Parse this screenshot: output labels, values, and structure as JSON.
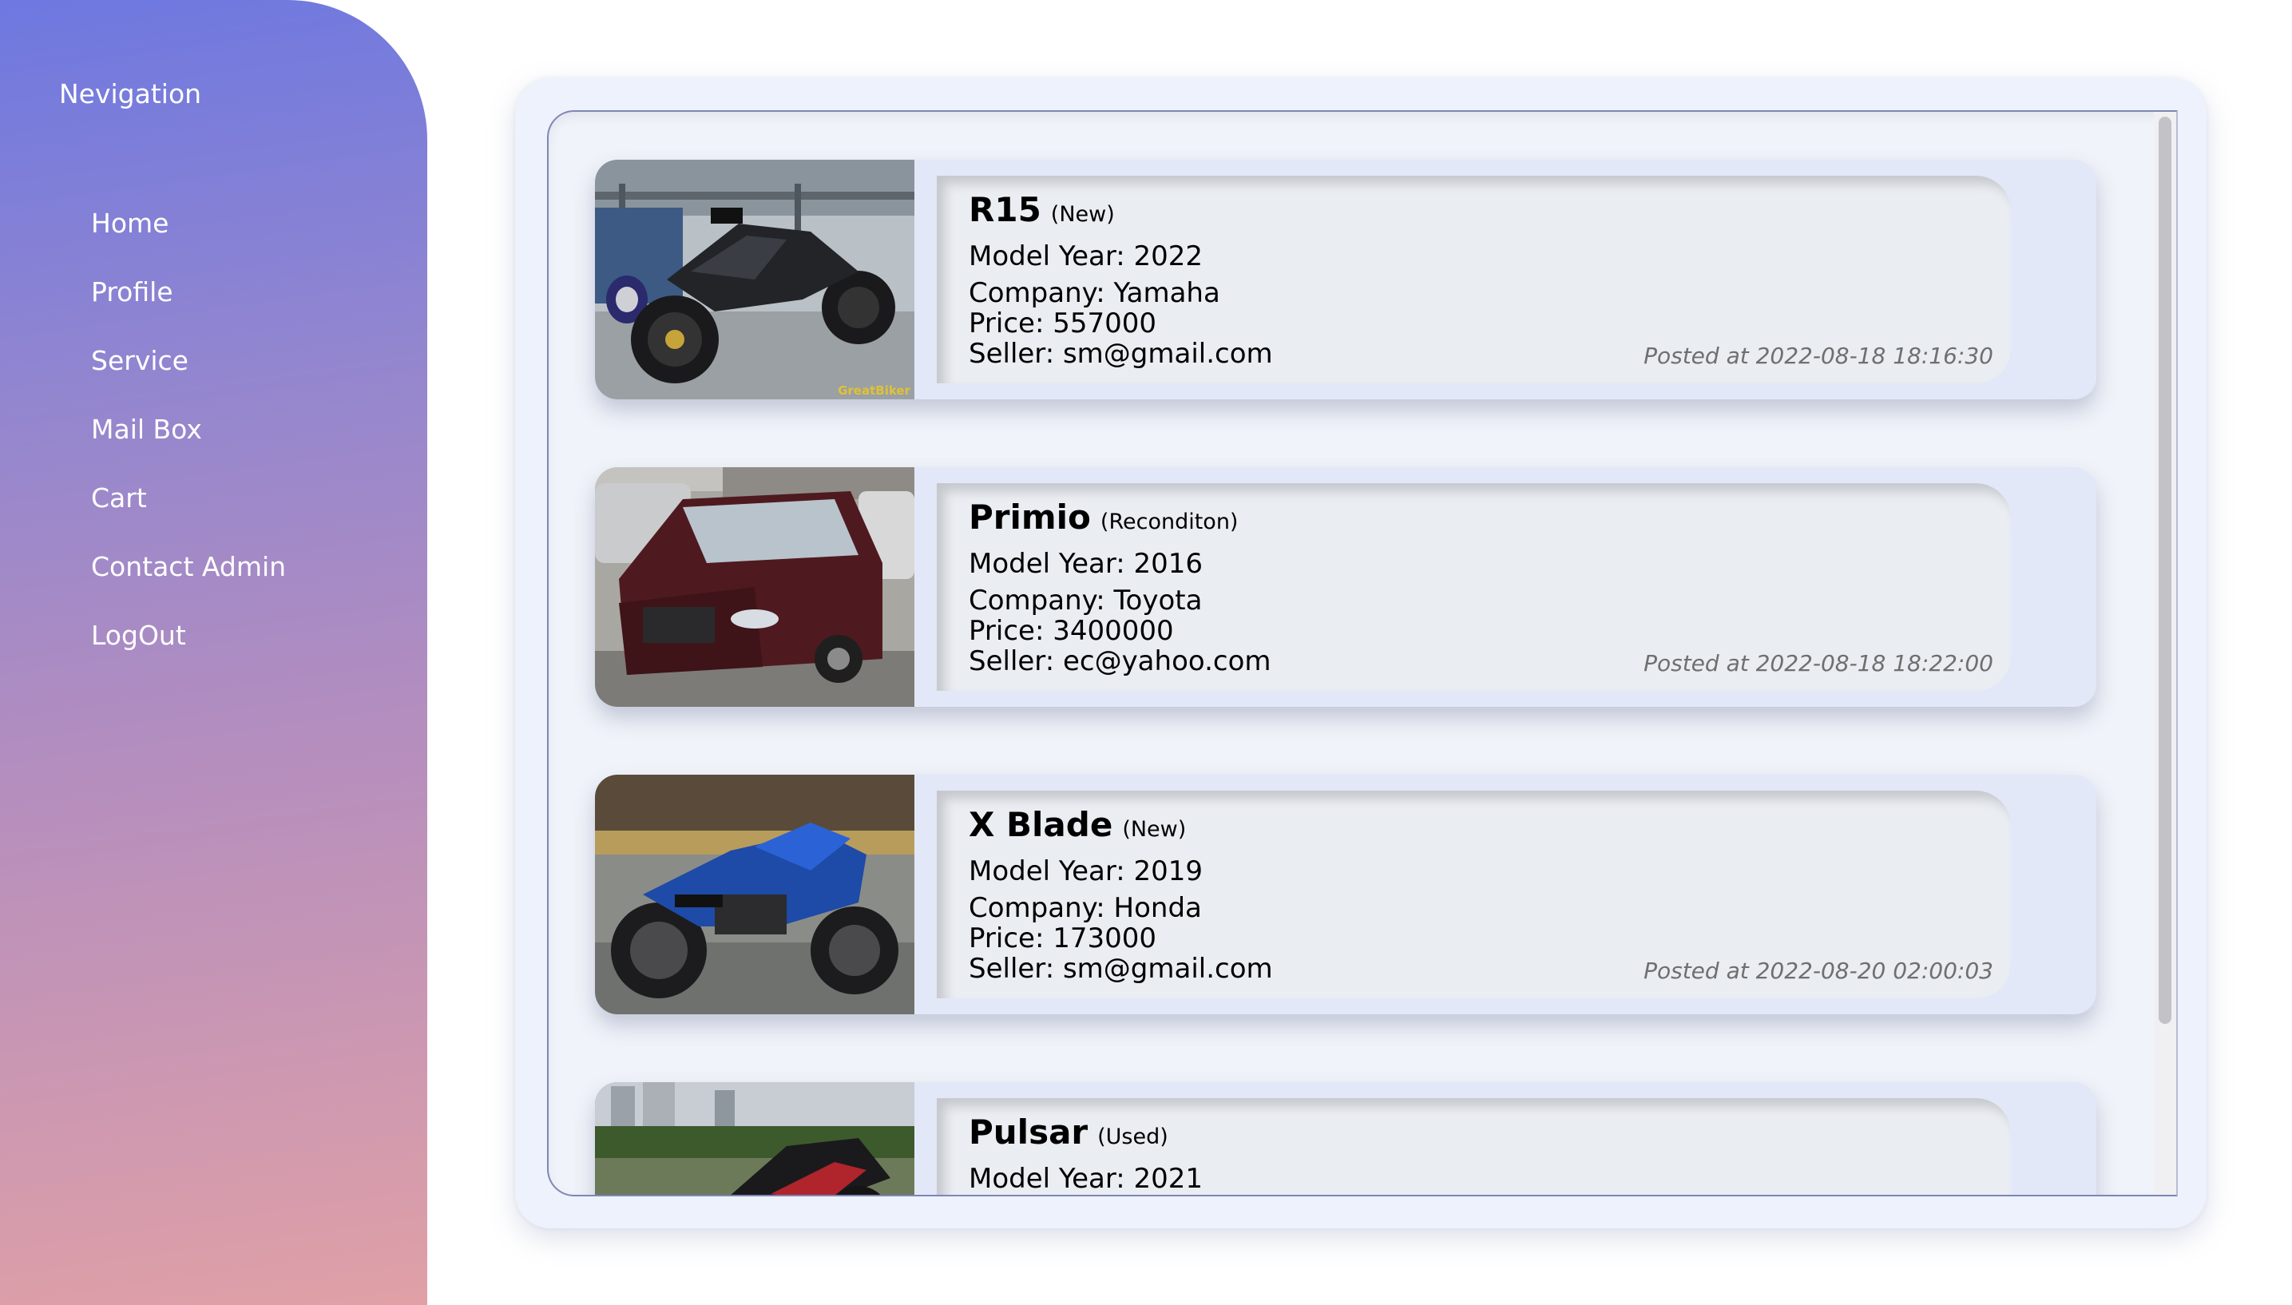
{
  "sidebar": {
    "title": "Nevigation",
    "items": [
      {
        "label": "Home"
      },
      {
        "label": "Profile"
      },
      {
        "label": "Service"
      },
      {
        "label": "Mail Box"
      },
      {
        "label": "Cart"
      },
      {
        "label": "Contact Admin"
      },
      {
        "label": "LogOut"
      }
    ]
  },
  "listings": [
    {
      "name": "R15",
      "condition": "(New)",
      "model_year": "Model Year: 2022",
      "company": "Company: Yamaha",
      "price": "Price: 557000",
      "seller": "Seller: sm@gmail.com",
      "posted": "Posted at 2022-08-18 18:16:30",
      "image": "sport-motorcycle-photo",
      "image_watermark": "GreatBiker"
    },
    {
      "name": "Primio",
      "condition": "(Reconditon)",
      "model_year": "Model Year: 2016",
      "company": "Company: Toyota",
      "price": "Price: 3400000",
      "seller": "Seller: ec@yahoo.com",
      "posted": "Posted at 2022-08-18 18:22:00",
      "image": "sedan-car-photo"
    },
    {
      "name": "X Blade",
      "condition": "(New)",
      "model_year": "Model Year: 2019",
      "company": "Company: Honda",
      "price": "Price: 173000",
      "seller": "Seller: sm@gmail.com",
      "posted": "Posted at 2022-08-20 02:00:03",
      "image": "blue-motorcycle-photo"
    },
    {
      "name": "Pulsar",
      "condition": "(Used)",
      "model_year": "Model Year: 2021",
      "image": "red-motorcycle-photo"
    }
  ],
  "colors": {
    "sidebar_gradient_top": "#6e78e0",
    "sidebar_gradient_bottom": "#e0a0a6",
    "card_background": "#e3e8f8",
    "posted_text": "#6f6f6f"
  }
}
